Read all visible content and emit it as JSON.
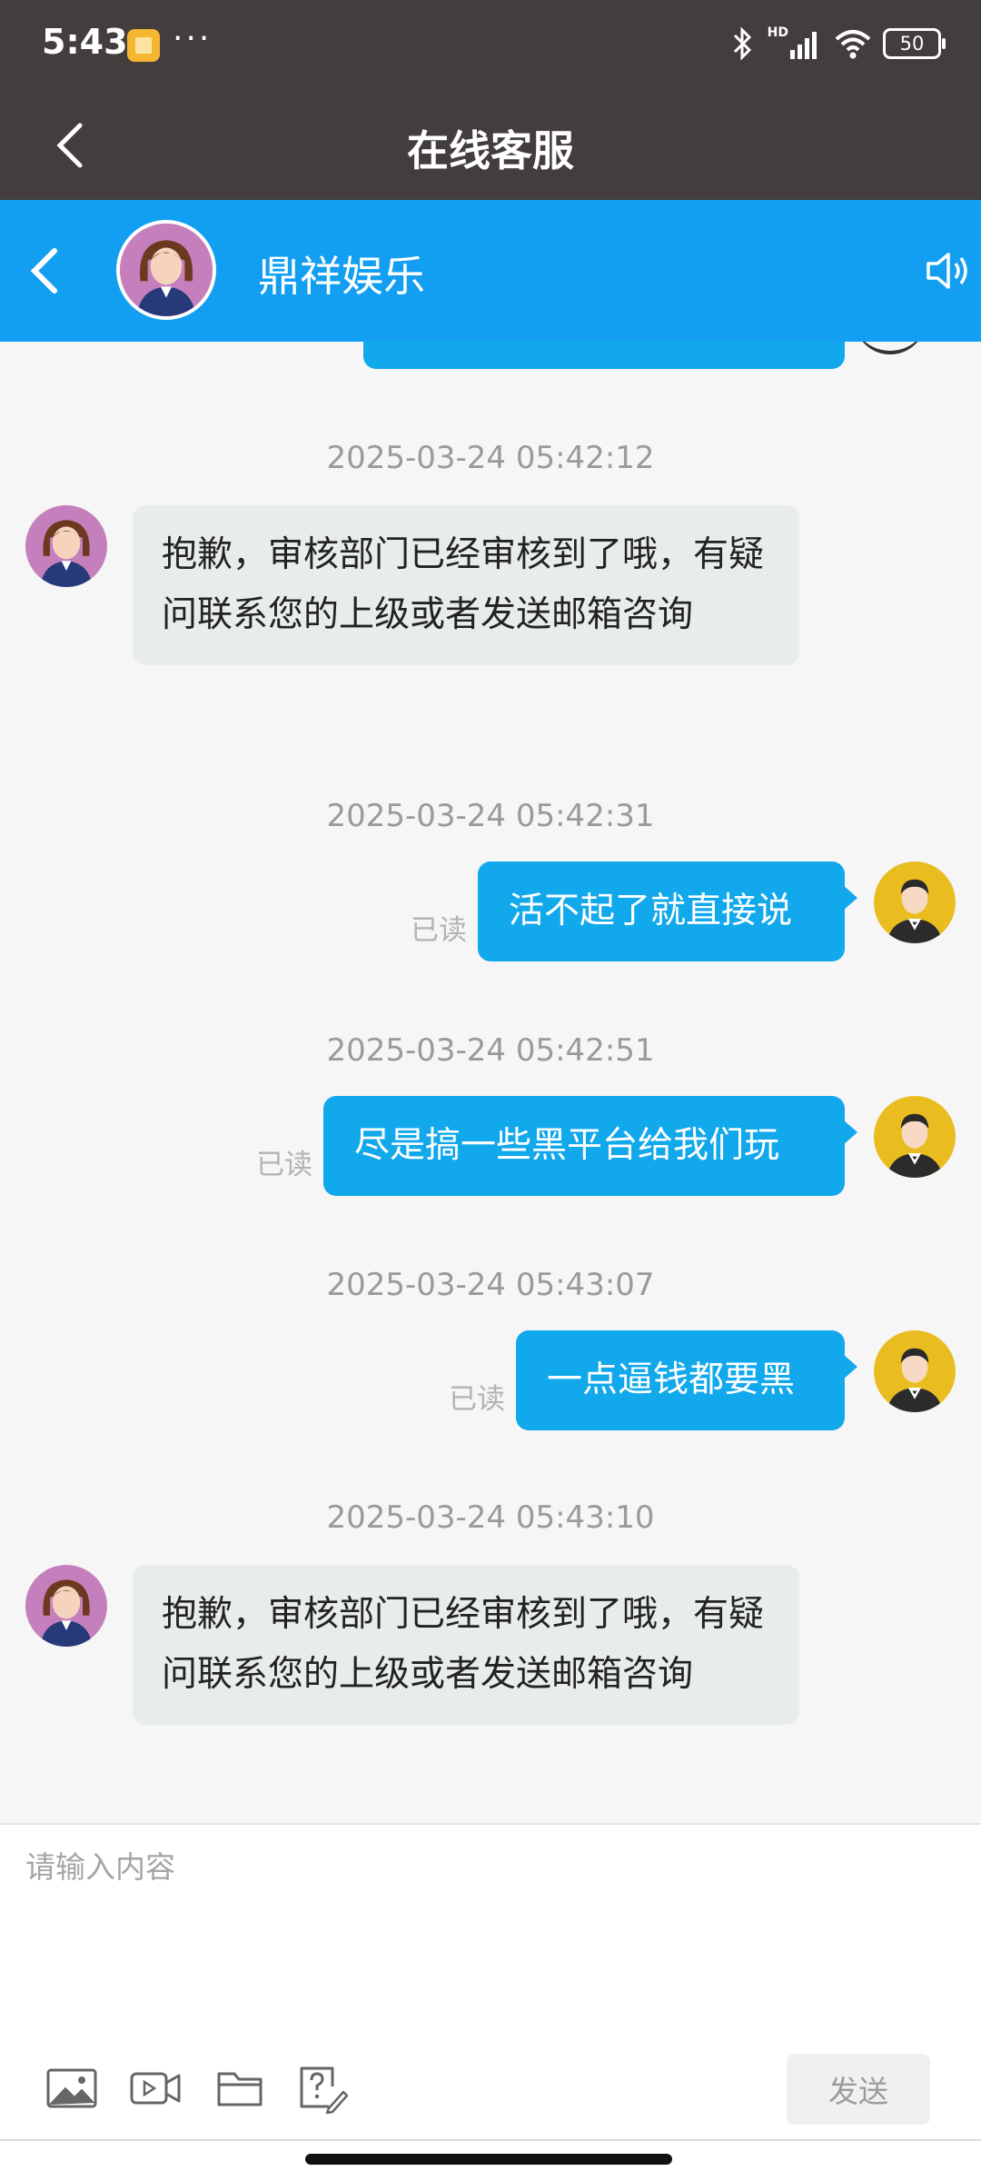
{
  "status_bar": {
    "time": "5:43",
    "more": "···",
    "hd_label": "HD",
    "battery": "50"
  },
  "header": {
    "title": "在线客服"
  },
  "chat_header": {
    "name": "鼎祥娱乐"
  },
  "messages": [
    {
      "timestamp": "2025-03-24 05:42:12",
      "side": "left",
      "text": "抱歉，审核部门已经审核到了哦，有疑问联系您的上级或者发送邮箱咨询"
    },
    {
      "timestamp": "2025-03-24 05:42:31",
      "side": "right",
      "text": "活不起了就直接说",
      "status": "已读"
    },
    {
      "timestamp": "2025-03-24 05:42:51",
      "side": "right",
      "text": "尽是搞一些黑平台给我们玩",
      "status": "已读"
    },
    {
      "timestamp": "2025-03-24 05:43:07",
      "side": "right",
      "text": "一点逼钱都要黑",
      "status": "已读"
    },
    {
      "timestamp": "2025-03-24 05:43:10",
      "side": "left",
      "text": "抱歉，审核部门已经审核到了哦，有疑问联系您的上级或者发送邮箱咨询"
    }
  ],
  "composer": {
    "placeholder": "请输入内容",
    "send_label": "发送",
    "tools": [
      "image-icon",
      "video-icon",
      "folder-icon",
      "question-icon"
    ]
  },
  "colors": {
    "header_bg": "#433d3d",
    "chat_bar": "#129ff2",
    "bubble_out": "#12a8ec",
    "bubble_in": "#e8ecec"
  }
}
